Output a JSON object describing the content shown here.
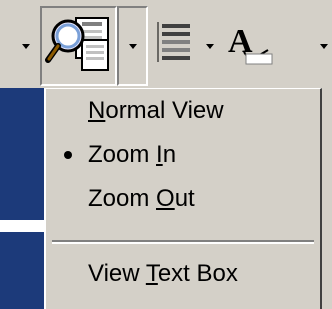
{
  "toolbar": {
    "buttons": [
      {
        "icon": "print-preview-magnifier-icon",
        "pressed": true
      },
      {
        "icon": "line-spacing-icon"
      },
      {
        "icon": "font-color-icon"
      }
    ]
  },
  "menu": {
    "items": [
      {
        "prefix": "",
        "mnemonic": "N",
        "suffix": "ormal View",
        "checked": false
      },
      {
        "prefix": "Zoom ",
        "mnemonic": "I",
        "suffix": "n",
        "checked": true
      },
      {
        "prefix": "Zoom ",
        "mnemonic": "O",
        "suffix": "ut",
        "checked": false
      },
      {
        "prefix": "View ",
        "mnemonic": "T",
        "suffix": "ext Box",
        "checked": false
      }
    ]
  }
}
